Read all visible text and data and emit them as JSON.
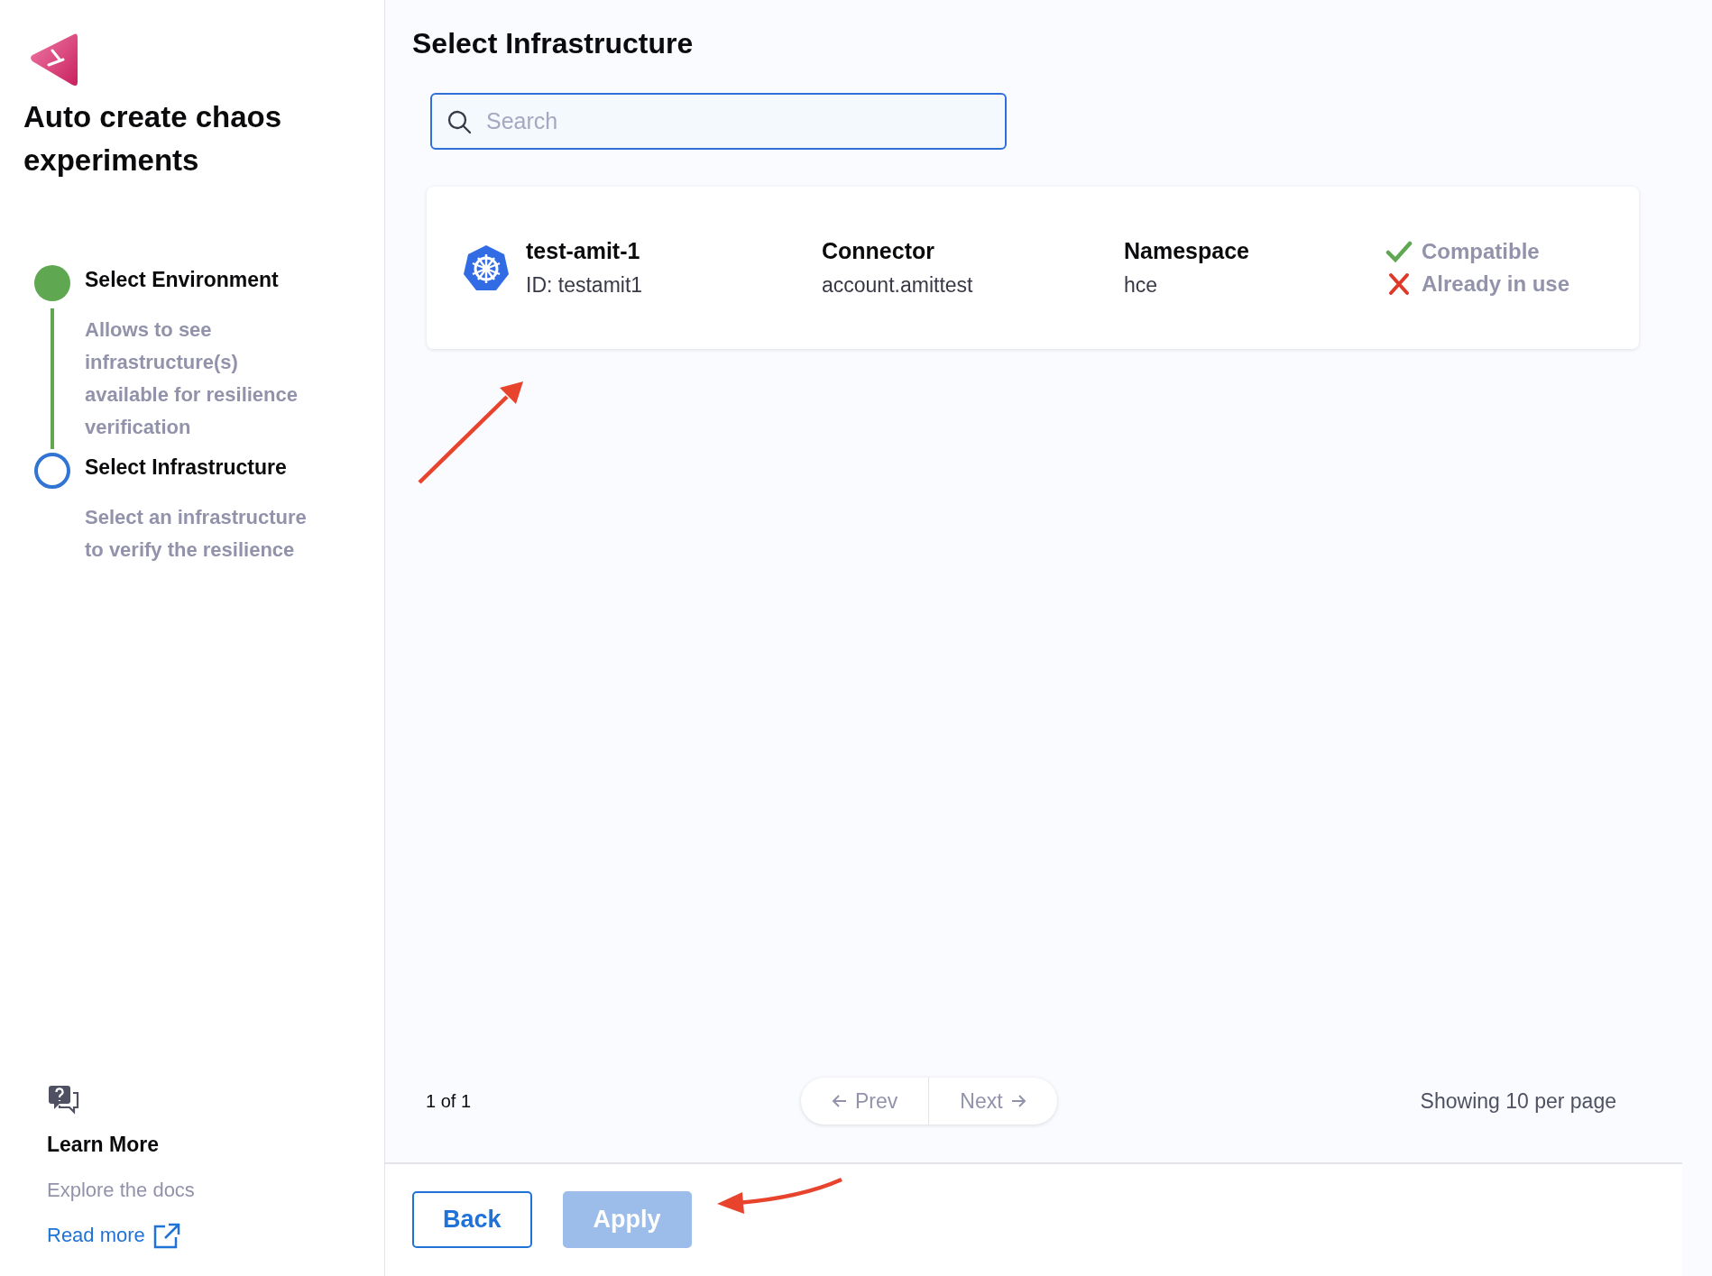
{
  "sidebar": {
    "title": "Auto create chaos experiments",
    "steps": [
      {
        "label": "Select Environment",
        "description": "Allows to see infrastructure(s) available for resilience verification",
        "done": true
      },
      {
        "label": "Select Infrastructure",
        "description": "Select an infrastructure to verify the resilience",
        "done": false
      }
    ],
    "learn_more": {
      "title": "Learn More",
      "subtitle": "Explore the docs",
      "link": "Read more"
    }
  },
  "main": {
    "title": "Select Infrastructure",
    "search": {
      "placeholder": "Search"
    },
    "infrastructures": [
      {
        "name": "test-amit-1",
        "id": "ID: testamit1",
        "connector_label": "Connector",
        "connector": "account.amittest",
        "namespace_label": "Namespace",
        "namespace": "hce",
        "statuses": [
          {
            "kind": "ok",
            "text": "Compatible"
          },
          {
            "kind": "error",
            "text": "Already in use"
          }
        ]
      }
    ],
    "pagination": {
      "page": "1 of 1",
      "prev": {
        "label": "Prev",
        "disabled": true
      },
      "next": {
        "label": "Next",
        "disabled": true
      },
      "page_size": "Showing 10 per page"
    },
    "buttons": [
      {
        "kind": "secondary",
        "label": "Back",
        "disabled": false
      },
      {
        "kind": "primary",
        "label": "Apply",
        "disabled": true
      }
    ]
  }
}
